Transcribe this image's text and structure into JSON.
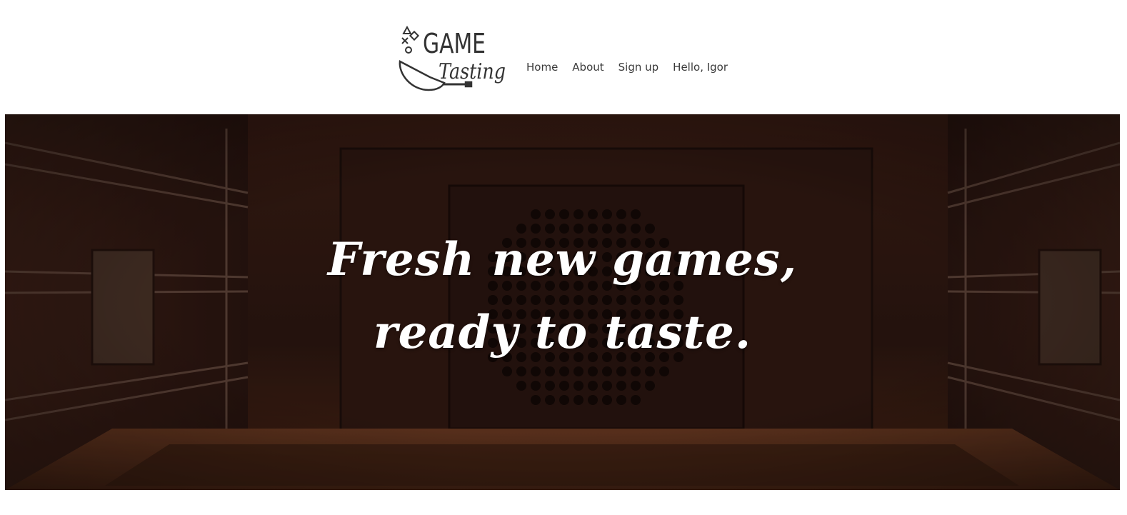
{
  "header": {
    "logo": {
      "word_top": "GAME",
      "word_bottom": "Tasting",
      "icon": "frying-pan-with-controller-symbols-icon"
    },
    "nav": [
      {
        "label": "Home"
      },
      {
        "label": "About"
      },
      {
        "label": "Sign up"
      },
      {
        "label": "Hello, Igor"
      }
    ]
  },
  "hero": {
    "line1": "Fresh new games,",
    "line2": "ready to taste.",
    "background": "oven-interior-image"
  },
  "colors": {
    "nav_text": "#3a3a3a",
    "hero_text": "#ffffff",
    "hero_bg": "#2a1812"
  }
}
